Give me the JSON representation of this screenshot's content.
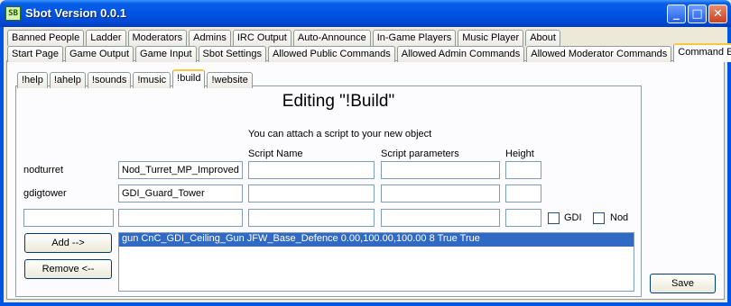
{
  "window": {
    "title": "Sbot Version 0.0.1",
    "icon_text": "SB",
    "minimize_glyph": "_",
    "maximize_glyph": "□",
    "close_glyph": "✕"
  },
  "main_tabs_row1": [
    "Banned People",
    "Ladder",
    "Moderators",
    "Admins",
    "IRC Output",
    "Auto-Announce",
    "In-Game Players",
    "Music Player",
    "About"
  ],
  "main_tabs_row2": [
    "Start Page",
    "Game Output",
    "Game Input",
    "Sbot Settings",
    "Allowed Public Commands",
    "Allowed Admin Commands",
    "Allowed Moderator Commands",
    "Command Editor"
  ],
  "active_main_tab": "Command Editor",
  "command_tabs": [
    "!help",
    "!ahelp",
    "!sounds",
    "!music",
    "!build",
    "!website"
  ],
  "active_command_tab": "!build",
  "editor": {
    "heading": "Editing \"!Build\"",
    "info": "You can attach a script to your new object",
    "columns": {
      "script_name": "Script Name",
      "script_parameters": "Script parameters",
      "height": "Height"
    },
    "rows": [
      {
        "label": "nodturret",
        "object": "Nod_Turret_MP_Improved",
        "script_name": "",
        "script_params": "",
        "height": ""
      },
      {
        "label": "gdigtower",
        "object": "GDI_Guard_Tower",
        "script_name": "",
        "script_params": "",
        "height": ""
      }
    ],
    "new_row": {
      "label": "",
      "object": "",
      "script_name": "",
      "script_params": "",
      "height": ""
    },
    "gdi_checkbox": {
      "label": "GDI",
      "checked": false
    },
    "nod_checkbox": {
      "label": "Nod",
      "checked": false
    },
    "add_button": "Add -->",
    "remove_button": "Remove <--",
    "list_items": [
      "gun CnC_GDI_Ceiling_Gun JFW_Base_Defence 0.00,100.00,100.00 8 True True"
    ],
    "selected_list_index": 0
  },
  "save_button": "Save",
  "colors": {
    "titlebar": "#0055e5",
    "tab_highlight": "#ffc83c",
    "selection": "#316ac5"
  }
}
